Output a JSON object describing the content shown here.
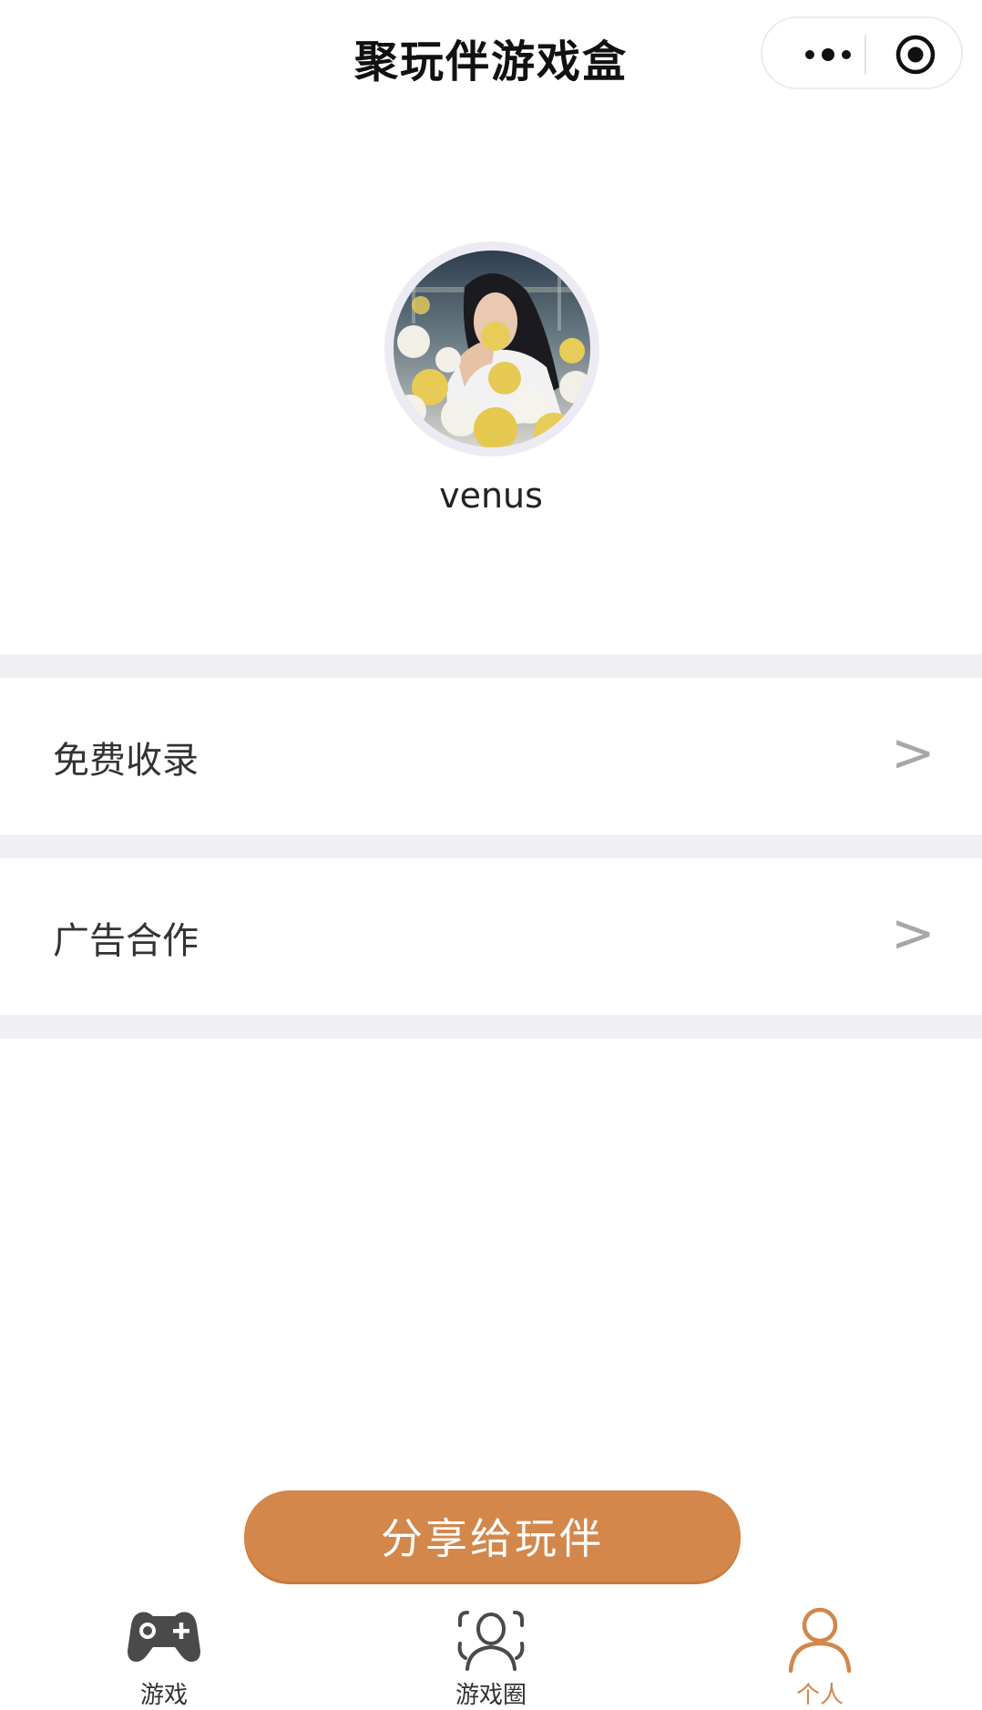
{
  "header": {
    "title": "聚玩伴游戏盒",
    "more_icon": "more-dots-icon",
    "close_icon": "target-circle-icon"
  },
  "profile": {
    "username": "venus",
    "avatar_icon": "avatar-photo"
  },
  "menu": [
    {
      "label": "免费收录",
      "arrow": ">"
    },
    {
      "label": "广告合作",
      "arrow": ">"
    }
  ],
  "share_button": {
    "label": "分享给玩伴"
  },
  "tabs": [
    {
      "label": "游戏",
      "icon": "gamepad-icon",
      "active": false
    },
    {
      "label": "游戏圈",
      "icon": "community-icon",
      "active": false
    },
    {
      "label": "个人",
      "icon": "person-icon",
      "active": true
    }
  ],
  "colors": {
    "accent": "#d3874b",
    "section_gap": "#efeff4",
    "arrow": "#a7a7a7",
    "inactive_icon": "#4a4a4a"
  }
}
